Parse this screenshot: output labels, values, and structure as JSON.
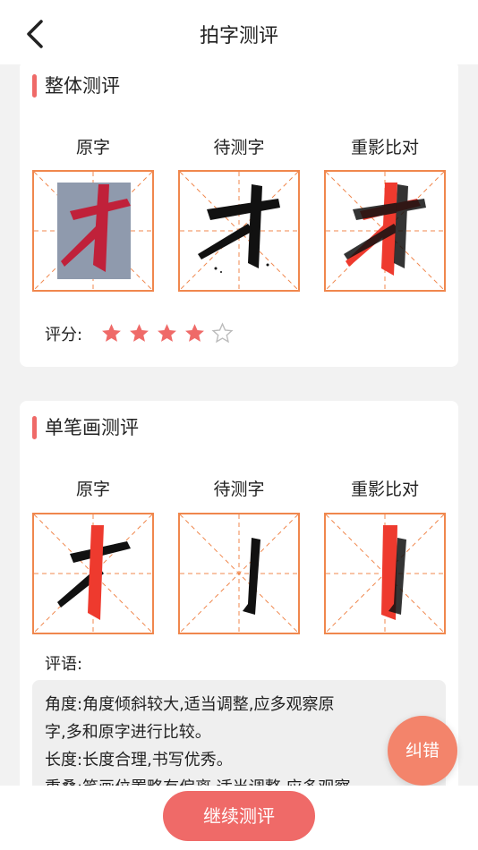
{
  "header": {
    "title": "拍字测评",
    "back_icon": "chevron-left-icon"
  },
  "overall": {
    "title": "整体测评",
    "columns": [
      "原字",
      "待测字",
      "重影比对"
    ],
    "score_label": "评分:",
    "rating": 4,
    "rating_max": 5
  },
  "stroke": {
    "title": "单笔画测评",
    "columns": [
      "原字",
      "待测字",
      "重影比对"
    ],
    "comment_label": "评语:",
    "comment_lines": [
      "角度:角度倾斜较大,适当调整,应多观察原",
      "字,多和原字进行比较。",
      "长度:长度合理,书写优秀。",
      "重叠:笔画位置略有偏离,适当调整,应多观察"
    ]
  },
  "fab_label": "纠错",
  "continue_label": "继续测评",
  "colors": {
    "accent": "#ef6a68",
    "grid_border": "#f0874d",
    "original_char": "#c0213a",
    "tested_char": "#111111",
    "highlight_stroke": "#ee3a2e"
  }
}
